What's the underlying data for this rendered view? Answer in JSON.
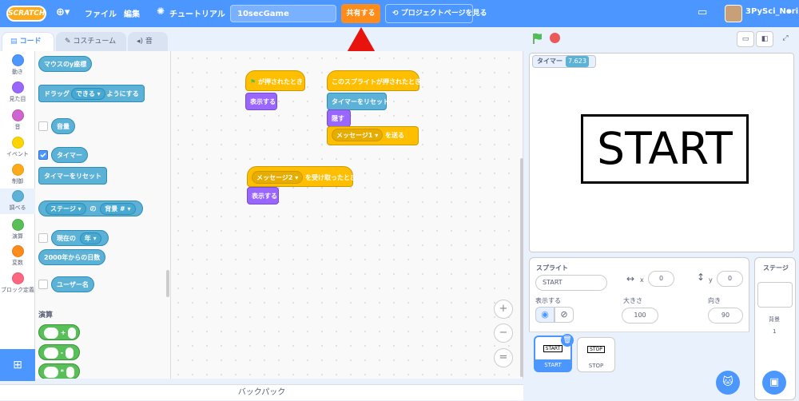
{
  "menubar": {
    "logo": "SCRATCH",
    "globe_icon": "globe-icon",
    "file": "ファイル",
    "edit": "編集",
    "tutorial": "チュートリアル",
    "project_title": "10secGame",
    "share": "共有する",
    "project_page": "プロジェクトページを見る",
    "folder_icon": "folder-icon",
    "username": "3PySci_Nori"
  },
  "tabs": {
    "code": "コード",
    "costume": "コスチューム",
    "sound": "音"
  },
  "categories": [
    {
      "label": "動き",
      "color": "#4c97ff"
    },
    {
      "label": "見た目",
      "color": "#9966ff"
    },
    {
      "label": "音",
      "color": "#cf63cf"
    },
    {
      "label": "イベント",
      "color": "#ffd500"
    },
    {
      "label": "制御",
      "color": "#ffab19"
    },
    {
      "label": "調べる",
      "color": "#5cb1d6"
    },
    {
      "label": "演算",
      "color": "#59c059"
    },
    {
      "label": "変数",
      "color": "#ff8c1a"
    },
    {
      "label": "ブロック定義",
      "color": "#ff6680"
    }
  ],
  "palette": {
    "mouse_y": "マウスのy座標",
    "drag_a": "ドラッグ",
    "drag_b": "できる",
    "drag_c": "ようにする",
    "loudness": "音量",
    "timer": "タイマー",
    "reset_timer": "タイマーをリセット",
    "stage": "ステージ",
    "of": "の",
    "backdrop": "背景 #",
    "current": "現在の",
    "year": "年",
    "days_since": "2000年からの日数",
    "username": "ユーザー名",
    "operators_heading": "演算",
    "plus": "+",
    "minus": "-",
    "times": "*"
  },
  "workspace": {
    "flag_hat": "が押されたとき",
    "show1": "表示する",
    "sprite_hat": "このスプライトが押されたとき",
    "reset_timer": "タイマーをリセット",
    "hide": "隠す",
    "message1": "メッセージ1",
    "send": "を送る",
    "message2": "メッセージ2",
    "receive": "を受け取ったとき",
    "show2": "表示する",
    "zoom_in": "+",
    "zoom_out": "−",
    "zoom_reset": "="
  },
  "backpack": "バックパック",
  "stage": {
    "monitor_label": "タイマー",
    "monitor_value": "7.623",
    "start_text": "START"
  },
  "sprite_info": {
    "sprite_label": "スプライト",
    "sprite_name": "START",
    "x_label": "x",
    "x_value": "0",
    "y_label": "y",
    "y_value": "0",
    "show_label": "表示する",
    "size_label": "大きさ",
    "size_value": "100",
    "direction_label": "向き",
    "direction_value": "90"
  },
  "sprites": [
    {
      "name": "START",
      "costume": "START"
    },
    {
      "name": "STOP",
      "costume": "STOP"
    }
  ],
  "stage_panel": {
    "title": "ステージ",
    "backdrops_label": "背景",
    "backdrops_count": "1"
  }
}
